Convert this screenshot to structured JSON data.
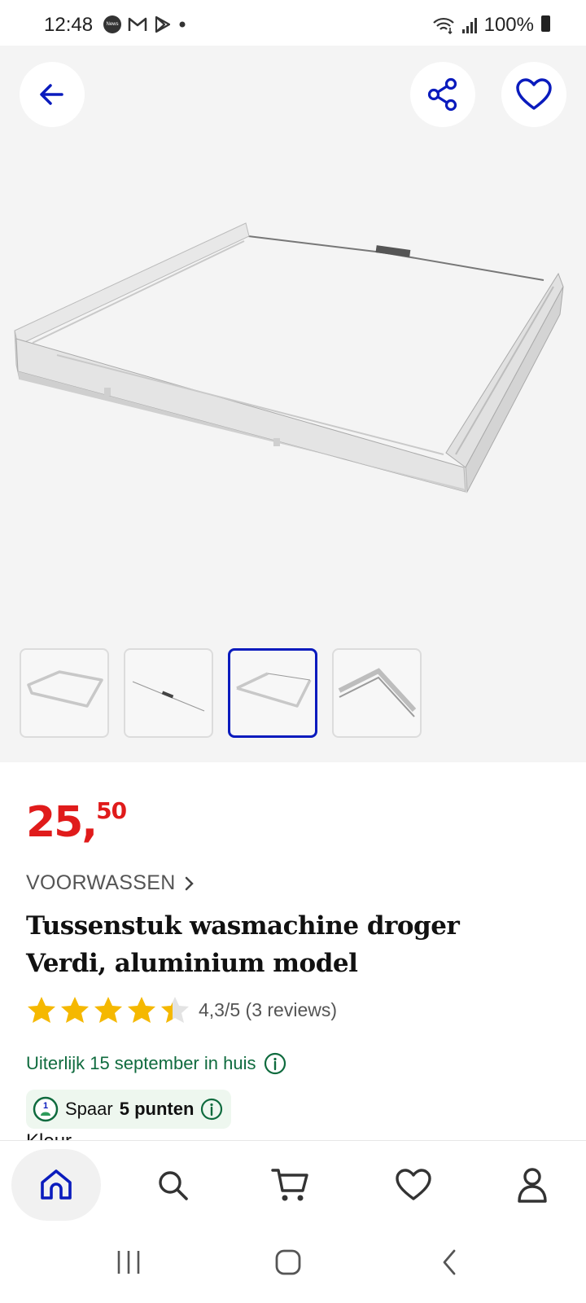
{
  "status_bar": {
    "time": "12:48",
    "news_badge": "News",
    "battery": "100%",
    "icons": [
      "news-icon",
      "gmail-icon",
      "play-store-icon",
      "notification-dot",
      "wifi-icon",
      "signal-icon",
      "battery-icon"
    ]
  },
  "gallery": {
    "back_icon": "arrow-left-icon",
    "share_icon": "share-icon",
    "favorite_icon": "heart-icon",
    "thumbnail_count": 4,
    "active_thumbnail_index": 2
  },
  "product": {
    "price_int": "25,",
    "price_dec": "50",
    "category": "VOORWASSEN",
    "title": "Tussenstuk wasmachine droger Verdi, aluminium model",
    "rating_value": 4.3,
    "rating_text": "4,3/5 (3 reviews)",
    "delivery": "Uiterlijk 15 september in huis",
    "points_prefix": "Spaar",
    "points_value": "5 punten",
    "color_label": "Kleur"
  },
  "bottom_nav": {
    "items": [
      "home-icon",
      "search-icon",
      "cart-icon",
      "heart-icon",
      "account-icon"
    ],
    "active": "home-icon"
  },
  "colors": {
    "accent": "#0a1bbd",
    "price": "#e01b1b",
    "delivery": "#0f6b3e",
    "star": "#f5b800"
  }
}
